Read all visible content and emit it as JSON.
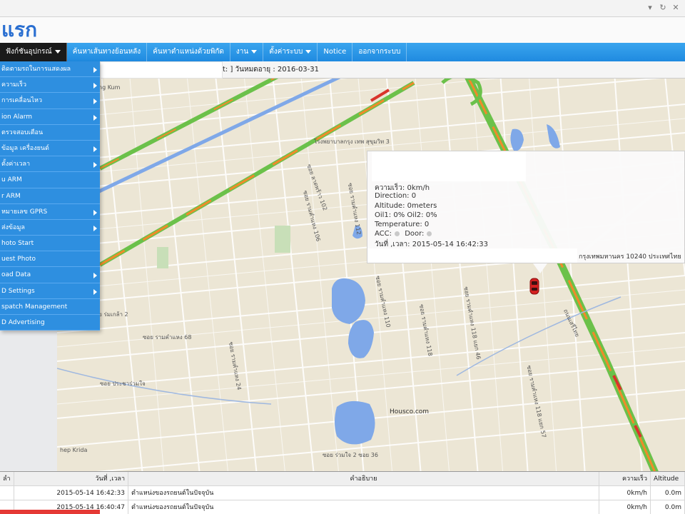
{
  "header": {
    "logo_text": "แรก"
  },
  "nav": {
    "items": [
      {
        "label": "ฟังก์ชันอุปกรณ์",
        "has_caret": true,
        "active": true
      },
      {
        "label": "ค้นหาเส้นทางย้อนหลัง",
        "has_caret": false,
        "active": false
      },
      {
        "label": "ค้นหาตำแหน่งด้วยพิกัด",
        "has_caret": false,
        "active": false
      },
      {
        "label": "งาน",
        "has_caret": true,
        "active": false
      },
      {
        "label": "ตั้งค่าระบบ",
        "has_caret": true,
        "active": false
      },
      {
        "label": "Notice",
        "has_caret": false,
        "active": false
      },
      {
        "label": "ออกจากระบบ",
        "has_caret": false,
        "active": false
      }
    ]
  },
  "info_bar": {
    "expiry_text": "t: ] วันหมดอายุ : 2016-03-31"
  },
  "menu": {
    "items": [
      {
        "label": "ติดตามรถในการแสดงผล",
        "has_sub": true
      },
      {
        "label": "ความเร็ว",
        "has_sub": true
      },
      {
        "label": "การเคลื่อนไหว",
        "has_sub": true
      },
      {
        "label": "ion Alarm",
        "has_sub": true
      },
      {
        "label": "ตรวจสอบเตือน",
        "has_sub": false
      },
      {
        "label": "ข้อมูล เครื่องยนต์",
        "has_sub": true
      },
      {
        "label": "ตั้งค่าเวลา",
        "has_sub": true
      },
      {
        "label": "u ARM",
        "has_sub": false
      },
      {
        "label": "r ARM",
        "has_sub": false
      },
      {
        "label": "หมายเลข GPRS",
        "has_sub": true
      },
      {
        "label": "ส่งข้อมูล",
        "has_sub": true
      },
      {
        "label": "hoto Start",
        "has_sub": false
      },
      {
        "label": "uest Photo",
        "has_sub": false
      },
      {
        "label": "oad Data",
        "has_sub": true
      },
      {
        "label": "D Settings",
        "has_sub": true
      },
      {
        "label": "spatch Management",
        "has_sub": false
      },
      {
        "label": "D Advertising",
        "has_sub": false
      }
    ]
  },
  "map": {
    "labels": [
      {
        "text": "ng Kum"
      },
      {
        "text": "โรงพยาบาลกรุง เทพ สุขุมวิท 3"
      },
      {
        "text": "ซอย ลาดพร้าว 102"
      },
      {
        "text": "ซอย รามคำแหง 106"
      },
      {
        "text": "ซอย รามคำแหง 112"
      },
      {
        "text": "ซอย รามคำแหง 110"
      },
      {
        "text": "ซอย ร่มเกล้า 2"
      },
      {
        "text": "ซอย รามคำแหง 68"
      },
      {
        "text": "ซอย รามคำแหง 24"
      },
      {
        "text": "ซอย รามคำแหง 118"
      },
      {
        "text": "ซอย รามคำแหง 118 แยก 46"
      },
      {
        "text": "ซอย รามคำแหง 118 แยก 57"
      },
      {
        "text": "ซอย ประชาร่วมใจ"
      },
      {
        "text": "Housco.com"
      },
      {
        "text": "hep Krida"
      },
      {
        "text": "ซอย ร่วมใจ 2 ซอย 36"
      },
      {
        "text": "ถนนเสรีไทย"
      }
    ]
  },
  "popup": {
    "speed": "ความเร็ว: 0km/h",
    "direction": "Direction: 0",
    "altitude": "Altitude: 0meters",
    "oil": "Oil1: 0%   Oil2: 0%",
    "temperature": "Temperature: 0",
    "acc_label": "ACC:",
    "door_label": "Door:",
    "datetime": "วันที่ ,เวลา: 2015-05-14 16:42:33",
    "address_tail": "กรุงเทพมหานคร 10240 ประเทศไทย"
  },
  "table": {
    "headers": {
      "c0": "ลำ",
      "c1": "วันที่ ,เวลา",
      "c2": "คำอธิบาย",
      "c3": "ความเร็ว",
      "c4": "Altitude"
    },
    "rows": [
      {
        "datetime": "2015-05-14 16:42:33",
        "desc": "ตำแหน่งของรถยนต์ในปัจจุบัน",
        "speed": "0km/h",
        "alt": "0.0m"
      },
      {
        "datetime": "2015-05-14 16:40:47",
        "desc": "ตำแหน่งของรถยนต์ในปัจจุบัน",
        "speed": "0km/h",
        "alt": "0.0m"
      }
    ]
  },
  "colors": {
    "nav_blue": "#1f8ae0",
    "menu_blue": "#2e8fe0",
    "water": "#7fa8e8",
    "traffic_green": "#6bc14a",
    "traffic_orange": "#f08a2a",
    "traffic_red": "#d9342b"
  }
}
